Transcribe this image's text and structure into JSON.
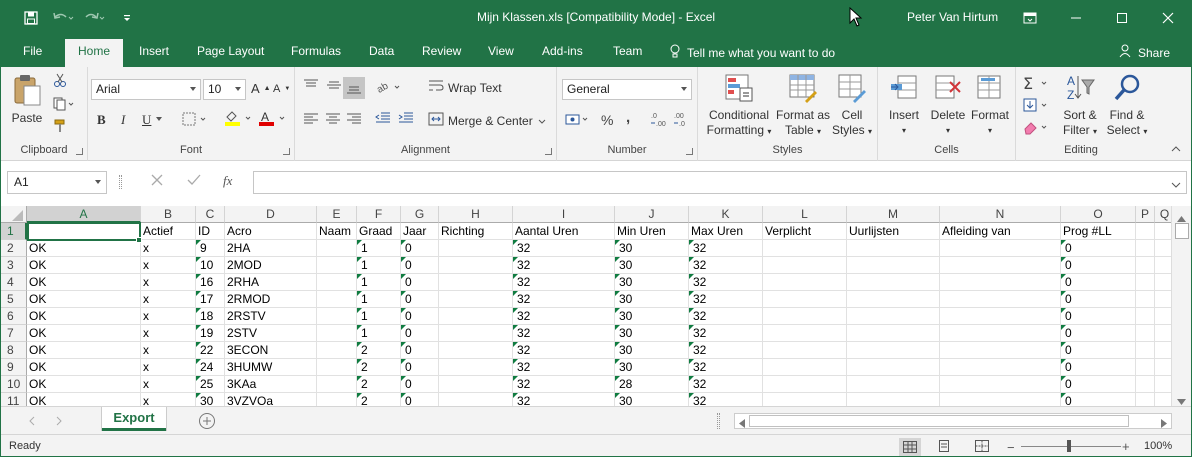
{
  "window": {
    "title": "Mijn Klassen.xls  [Compatibility Mode] - Excel",
    "user": "Peter Van Hirtum"
  },
  "tabs": [
    "File",
    "Home",
    "Insert",
    "Page Layout",
    "Formulas",
    "Data",
    "Review",
    "View",
    "Add-ins",
    "Team"
  ],
  "tell_me": "Tell me what you want to do",
  "share": "Share",
  "ribbon": {
    "clipboard": {
      "paste": "Paste",
      "label": "Clipboard"
    },
    "font": {
      "name": "Arial",
      "size": "10",
      "label": "Font",
      "bold": "B",
      "italic": "I",
      "underline": "U"
    },
    "alignment": {
      "wrap": "Wrap Text",
      "merge": "Merge & Center",
      "label": "Alignment"
    },
    "number": {
      "format": "General",
      "label": "Number",
      "percent": "%",
      "comma": ","
    },
    "styles": {
      "conditional_1": "Conditional",
      "conditional_2": "Formatting",
      "table_1": "Format as",
      "table_2": "Table",
      "cell_1": "Cell",
      "cell_2": "Styles",
      "label": "Styles"
    },
    "cells": {
      "insert": "Insert",
      "delete": "Delete",
      "format": "Format",
      "label": "Cells"
    },
    "editing": {
      "sort_1": "Sort &",
      "sort_2": "Filter",
      "find_1": "Find &",
      "find_2": "Select",
      "label": "Editing"
    }
  },
  "formula_bar": {
    "name_box": "A1",
    "fx": "fx",
    "value": ""
  },
  "columns": [
    {
      "letter": "A",
      "header": ""
    },
    {
      "letter": "B",
      "header": "Actief"
    },
    {
      "letter": "C",
      "header": "ID"
    },
    {
      "letter": "D",
      "header": "Acro"
    },
    {
      "letter": "E",
      "header": "Naam"
    },
    {
      "letter": "F",
      "header": "Graad"
    },
    {
      "letter": "G",
      "header": "Jaar"
    },
    {
      "letter": "H",
      "header": "Richting"
    },
    {
      "letter": "I",
      "header": "Aantal Uren"
    },
    {
      "letter": "J",
      "header": "Min Uren"
    },
    {
      "letter": "K",
      "header": "Max Uren"
    },
    {
      "letter": "L",
      "header": "Verplicht"
    },
    {
      "letter": "M",
      "header": "Uurlijsten"
    },
    {
      "letter": "N",
      "header": "Afleiding van"
    },
    {
      "letter": "O",
      "header": "Prog #LL"
    },
    {
      "letter": "P",
      "header": ""
    },
    {
      "letter": "Q",
      "header": ""
    }
  ],
  "row_numbers": [
    "1",
    "2",
    "3",
    "4",
    "5",
    "6",
    "7",
    "8",
    "9",
    "10",
    "11"
  ],
  "rows": [
    [
      "OK",
      "x",
      "9",
      "2HA",
      "",
      "1",
      "0",
      "",
      "32",
      "30",
      "32",
      "",
      "",
      "",
      "0"
    ],
    [
      "OK",
      "x",
      "10",
      "2MOD",
      "",
      "1",
      "0",
      "",
      "32",
      "30",
      "32",
      "",
      "",
      "",
      "0"
    ],
    [
      "OK",
      "x",
      "16",
      "2RHA",
      "",
      "1",
      "0",
      "",
      "32",
      "30",
      "32",
      "",
      "",
      "",
      "0"
    ],
    [
      "OK",
      "x",
      "17",
      "2RMOD",
      "",
      "1",
      "0",
      "",
      "32",
      "30",
      "32",
      "",
      "",
      "",
      "0"
    ],
    [
      "OK",
      "x",
      "18",
      "2RSTV",
      "",
      "1",
      "0",
      "",
      "32",
      "30",
      "32",
      "",
      "",
      "",
      "0"
    ],
    [
      "OK",
      "x",
      "19",
      "2STV",
      "",
      "1",
      "0",
      "",
      "32",
      "30",
      "32",
      "",
      "",
      "",
      "0"
    ],
    [
      "OK",
      "x",
      "22",
      "3ECON",
      "",
      "2",
      "0",
      "",
      "32",
      "30",
      "32",
      "",
      "",
      "",
      "0"
    ],
    [
      "OK",
      "x",
      "24",
      "3HUMW",
      "",
      "2",
      "0",
      "",
      "32",
      "30",
      "32",
      "",
      "",
      "",
      "0"
    ],
    [
      "OK",
      "x",
      "25",
      "3KAa",
      "",
      "2",
      "0",
      "",
      "32",
      "28",
      "32",
      "",
      "",
      "",
      "0"
    ],
    [
      "OK",
      "x",
      "30",
      "3VZVOa",
      "",
      "2",
      "0",
      "",
      "32",
      "30",
      "32",
      "",
      "",
      "",
      "0"
    ]
  ],
  "sheet_tab": "Export",
  "status": {
    "ready": "Ready",
    "zoom": "100%"
  },
  "colors": {
    "accent": "#217346",
    "ribbon_bg": "#f3f3f3",
    "error_triangle": "#107c41"
  }
}
